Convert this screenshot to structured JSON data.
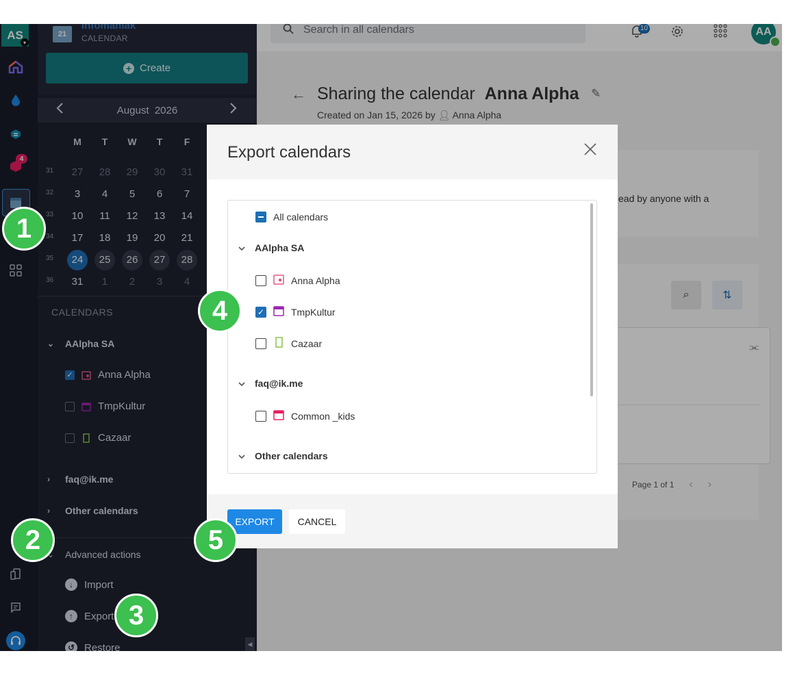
{
  "rail": {
    "workspace_initials": "AS",
    "store_badge": "4"
  },
  "sidebar": {
    "brand": "infomaniak",
    "brand_sub": "CALENDAR",
    "logo_number": "21",
    "create_label": "Create",
    "month": "August",
    "year": "2026",
    "weekdays": [
      "M",
      "T",
      "W",
      "T",
      "F"
    ],
    "weeks": [
      {
        "num": "31",
        "days": [
          "27",
          "28",
          "29",
          "30",
          "31"
        ]
      },
      {
        "num": "32",
        "days": [
          "3",
          "4",
          "5",
          "6",
          "7"
        ]
      },
      {
        "num": "33",
        "days": [
          "10",
          "11",
          "12",
          "13",
          "14"
        ]
      },
      {
        "num": "34",
        "days": [
          "17",
          "18",
          "19",
          "20",
          "21"
        ]
      },
      {
        "num": "35",
        "days": [
          "24",
          "25",
          "26",
          "27",
          "28"
        ]
      },
      {
        "num": "36",
        "days": [
          "31",
          "1",
          "2",
          "3",
          "4"
        ]
      }
    ],
    "calendars_title": "CALENDARS",
    "group1": "AAlpha SA",
    "items": [
      "Anna Alpha",
      "TmpKultur",
      "Cazaar"
    ],
    "group2": "faq@ik.me",
    "group3": "Other calendars",
    "advanced": "Advanced actions",
    "actions": [
      "Import",
      "Export",
      "Restore"
    ]
  },
  "topbar": {
    "search_placeholder": "Search in all calendars",
    "notifications_count": "10",
    "user_initials": "AA"
  },
  "page": {
    "title_prefix": "Sharing the calendar",
    "title_name": "Anna Alpha",
    "created": "Created on Jan 15, 2026 by",
    "created_by": "Anna Alpha",
    "card_text": "ead by anyone with a",
    "pager": "Page 1 of 1"
  },
  "modal": {
    "title": "Export calendars",
    "all_label": "All calendars",
    "group1": "AAlpha SA",
    "group1_items": [
      {
        "label": "Anna Alpha",
        "checked": false,
        "color": "#e05a8a"
      },
      {
        "label": "TmpKultur",
        "checked": true,
        "color": "#9c27b0"
      },
      {
        "label": "Cazaar",
        "checked": false,
        "color": "#8bc34a"
      }
    ],
    "group2": "faq@ik.me",
    "group2_items": [
      {
        "label": "Common _kids",
        "checked": false,
        "color": "#e91e63"
      }
    ],
    "group3": "Other calendars",
    "export_label": "EXPORT",
    "cancel_label": "CANCEL"
  },
  "steps": [
    "1",
    "2",
    "3",
    "4",
    "5"
  ],
  "colors": {
    "accent": "#1e6fb5",
    "create_button": "#127c82",
    "export_button": "#1e88e5",
    "step_marker": "#3cc04f"
  }
}
